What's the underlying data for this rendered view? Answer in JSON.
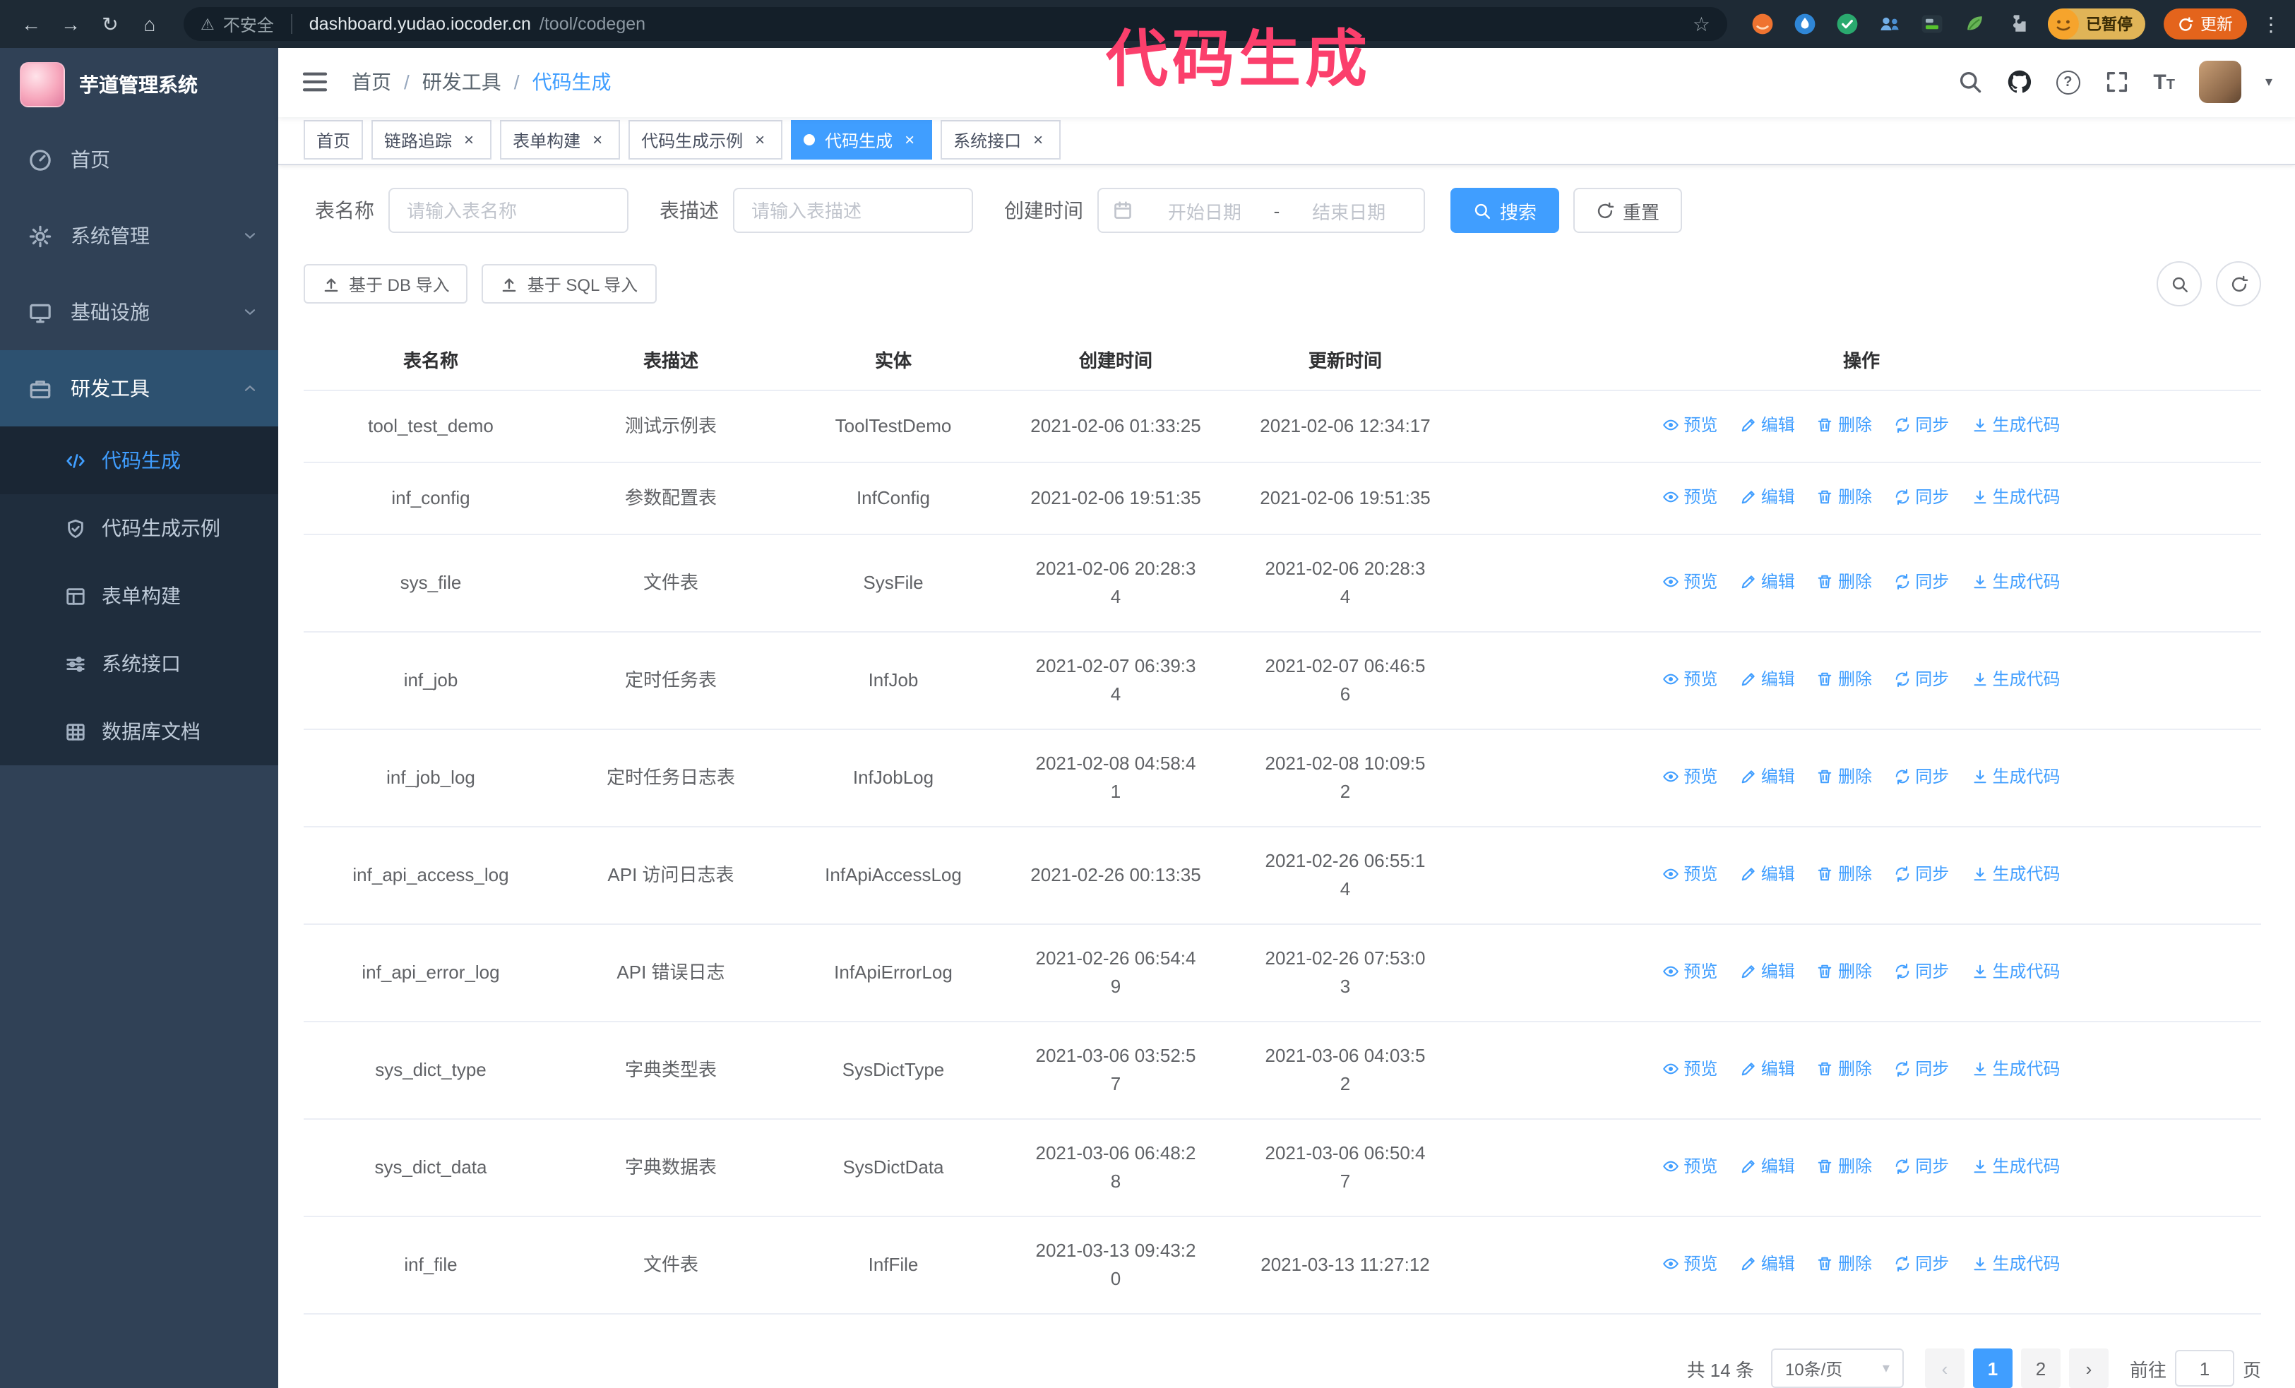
{
  "annotation": {
    "text": "代码生成",
    "color": "#fb3f6c"
  },
  "browser": {
    "security_label": "不安全",
    "url_host": "dashboard.yudao.iocoder.cn",
    "url_path": "/tool/codegen",
    "paused_badge": "已暂停",
    "update_button": "更新"
  },
  "icons": {
    "back": "←",
    "forward": "→",
    "reload": "↻",
    "home": "⌂",
    "warning": "⚠",
    "star": "☆",
    "kebab": "⋮",
    "close": "×",
    "caret_down": "▾",
    "question": "?",
    "text_large": "T",
    "text_small": "T",
    "prev": "‹",
    "next": "›"
  },
  "sidebar": {
    "title": "芋道管理系统",
    "items": [
      {
        "label": "首页"
      },
      {
        "label": "系统管理"
      },
      {
        "label": "基础设施"
      },
      {
        "label": "研发工具"
      }
    ],
    "subitems": [
      {
        "label": "代码生成"
      },
      {
        "label": "代码生成示例"
      },
      {
        "label": "表单构建"
      },
      {
        "label": "系统接口"
      },
      {
        "label": "数据库文档"
      }
    ]
  },
  "breadcrumb": {
    "separator": "/",
    "items": [
      "首页",
      "研发工具",
      "代码生成"
    ]
  },
  "tabs": [
    {
      "label": "首页"
    },
    {
      "label": "链路追踪"
    },
    {
      "label": "表单构建"
    },
    {
      "label": "代码生成示例"
    },
    {
      "label": "代码生成"
    },
    {
      "label": "系统接口"
    }
  ],
  "filters": {
    "table_name_label": "表名称",
    "table_name_placeholder": "请输入表名称",
    "table_desc_label": "表描述",
    "table_desc_placeholder": "请输入表描述",
    "create_time_label": "创建时间",
    "start_placeholder": "开始日期",
    "range_separator": "-",
    "end_placeholder": "结束日期",
    "search_button": "搜索",
    "reset_button": "重置"
  },
  "toolbar": {
    "import_db_button": "基于 DB 导入",
    "import_sql_button": "基于 SQL 导入"
  },
  "table": {
    "headers": [
      "表名称",
      "表描述",
      "实体",
      "创建时间",
      "更新时间",
      "操作"
    ],
    "rows": [
      {
        "name": "tool_test_demo",
        "desc": "测试示例表",
        "entity": "ToolTestDemo",
        "ctime": "2021-02-06 01:33:25",
        "utime": "2021-02-06 12:34:17"
      },
      {
        "name": "inf_config",
        "desc": "参数配置表",
        "entity": "InfConfig",
        "ctime": "2021-02-06 19:51:35",
        "utime": "2021-02-06 19:51:35"
      },
      {
        "name": "sys_file",
        "desc": "文件表",
        "entity": "SysFile",
        "ctime": "2021-02-06 20:28:3\n4",
        "utime": "2021-02-06 20:28:3\n4"
      },
      {
        "name": "inf_job",
        "desc": "定时任务表",
        "entity": "InfJob",
        "ctime": "2021-02-07 06:39:3\n4",
        "utime": "2021-02-07 06:46:5\n6"
      },
      {
        "name": "inf_job_log",
        "desc": "定时任务日志表",
        "entity": "InfJobLog",
        "ctime": "2021-02-08 04:58:4\n1",
        "utime": "2021-02-08 10:09:5\n2"
      },
      {
        "name": "inf_api_access_log",
        "desc": "API 访问日志表",
        "entity": "InfApiAccessLog",
        "ctime": "2021-02-26 00:13:35",
        "utime": "2021-02-26 06:55:1\n4"
      },
      {
        "name": "inf_api_error_log",
        "desc": "API 错误日志",
        "entity": "InfApiErrorLog",
        "ctime": "2021-02-26 06:54:4\n9",
        "utime": "2021-02-26 07:53:0\n3"
      },
      {
        "name": "sys_dict_type",
        "desc": "字典类型表",
        "entity": "SysDictType",
        "ctime": "2021-03-06 03:52:5\n7",
        "utime": "2021-03-06 04:03:5\n2"
      },
      {
        "name": "sys_dict_data",
        "desc": "字典数据表",
        "entity": "SysDictData",
        "ctime": "2021-03-06 06:48:2\n8",
        "utime": "2021-03-06 06:50:4\n7"
      },
      {
        "name": "inf_file",
        "desc": "文件表",
        "entity": "InfFile",
        "ctime": "2021-03-13 09:43:2\n0",
        "utime": "2021-03-13 11:27:12"
      }
    ]
  },
  "ops": {
    "preview": "预览",
    "edit": "编辑",
    "delete": "删除",
    "sync": "同步",
    "generate": "生成代码"
  },
  "pagination": {
    "total": "共 14 条",
    "page_size": "10条/页",
    "pages": [
      "1",
      "2"
    ],
    "goto_label": "前往",
    "goto_value": "1",
    "page_unit": "页"
  },
  "colors": {
    "accent": "#409eff",
    "annotation": "#fb3f6c",
    "sidebar_bg": "#304156",
    "submenu_bg": "#1f2d3d"
  }
}
